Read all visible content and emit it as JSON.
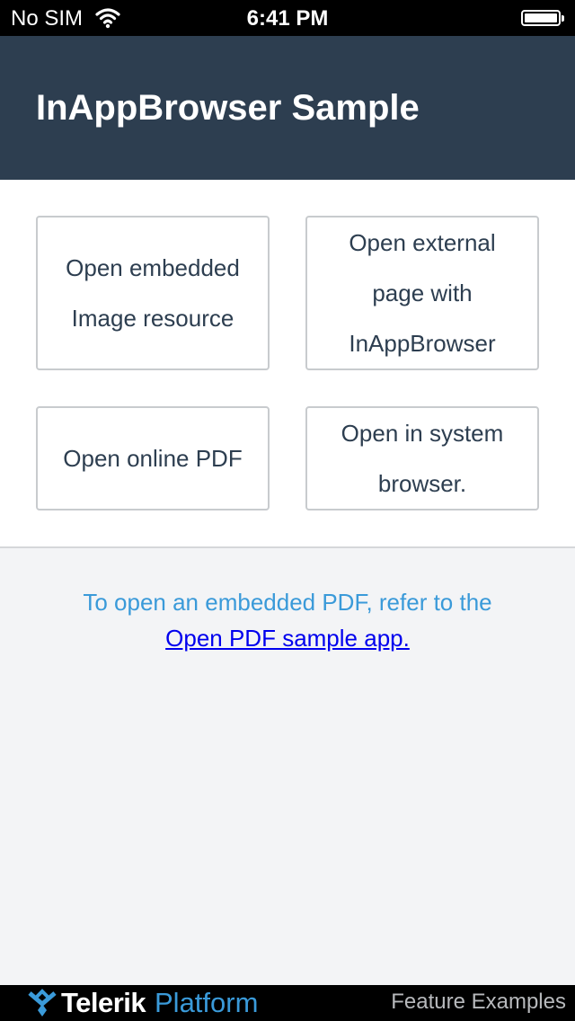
{
  "status_bar": {
    "carrier": "No SIM",
    "time": "6:41 PM"
  },
  "header": {
    "title": "InAppBrowser Sample"
  },
  "buttons": [
    {
      "label": "Open embedded Image resource"
    },
    {
      "label": "Open external page with InAppBrowser"
    },
    {
      "label": "Open online PDF"
    },
    {
      "label": "Open in system browser."
    }
  ],
  "info": {
    "message": "To open an embedded PDF, refer to the",
    "link": "Open PDF sample app."
  },
  "footer": {
    "brand_bold": "Telerik",
    "brand_light": "Platform",
    "feature_label": "Feature Examples"
  },
  "colors": {
    "header_bg": "#2d3e50",
    "accent": "#3a9ad9",
    "link": "#0000ee"
  }
}
